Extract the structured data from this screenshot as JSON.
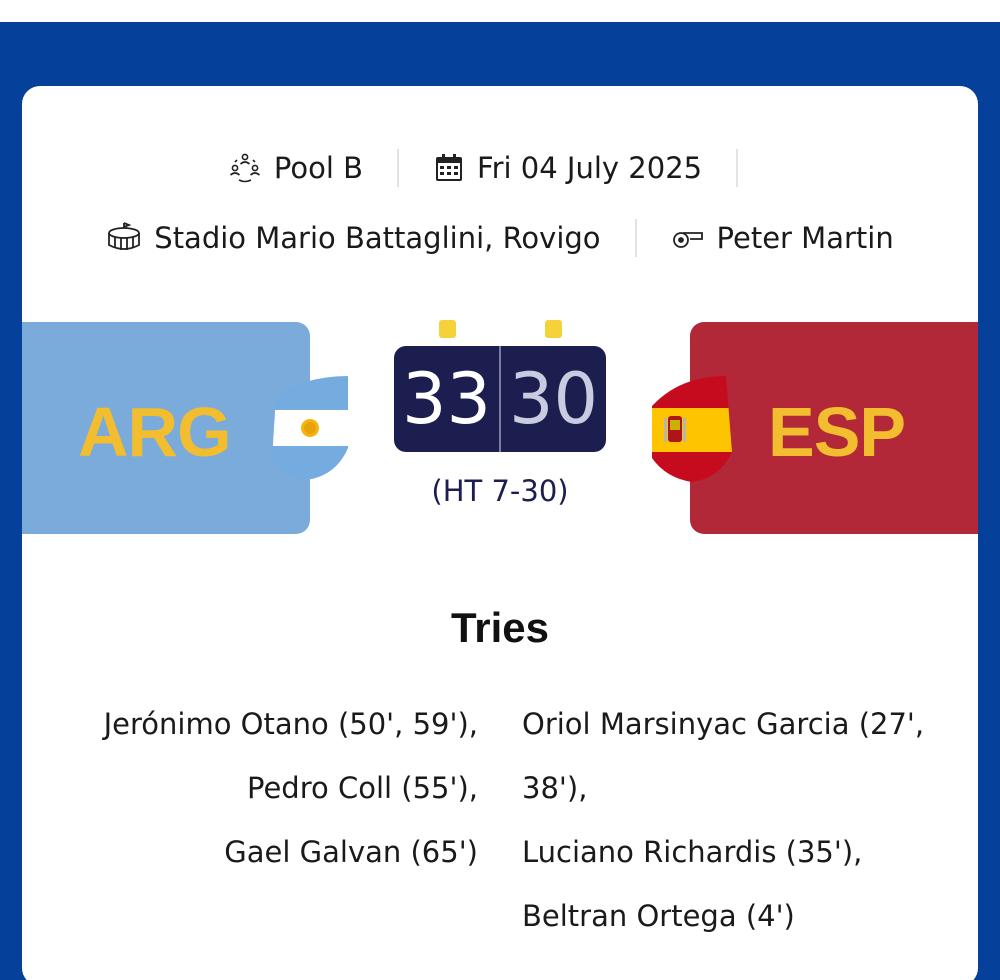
{
  "match": {
    "pool": "Pool B",
    "date": "Fri 04 July 2025",
    "venue": "Stadio Mario Battaglini, Rovigo",
    "referee": "Peter Martin"
  },
  "home": {
    "code": "ARG",
    "score": "33",
    "panel_color": "#7aabdb",
    "tries": [
      "Jerónimo Otano (50', 59'),",
      "Pedro Coll (55'),",
      "Gael Galvan (65')"
    ]
  },
  "away": {
    "code": "ESP",
    "score": "30",
    "panel_color": "#b22838",
    "tries": [
      "Oriol Marsinyac Garcia (27',",
      "38'),",
      "Luciano Richardis (35'),",
      "Beltran Ortega (4')"
    ]
  },
  "halftime": "(HT 7-30)",
  "tries_heading": "Tries",
  "colors": {
    "brand_blue": "#05409a",
    "team_code_gold": "#f2bd2f",
    "scoreboard_navy": "#1c1e4f",
    "indicator_yellow": "#f5d13a"
  },
  "icons": {
    "pool": "people-group-icon",
    "date": "calendar-icon",
    "venue": "stadium-icon",
    "referee": "whistle-icon"
  }
}
